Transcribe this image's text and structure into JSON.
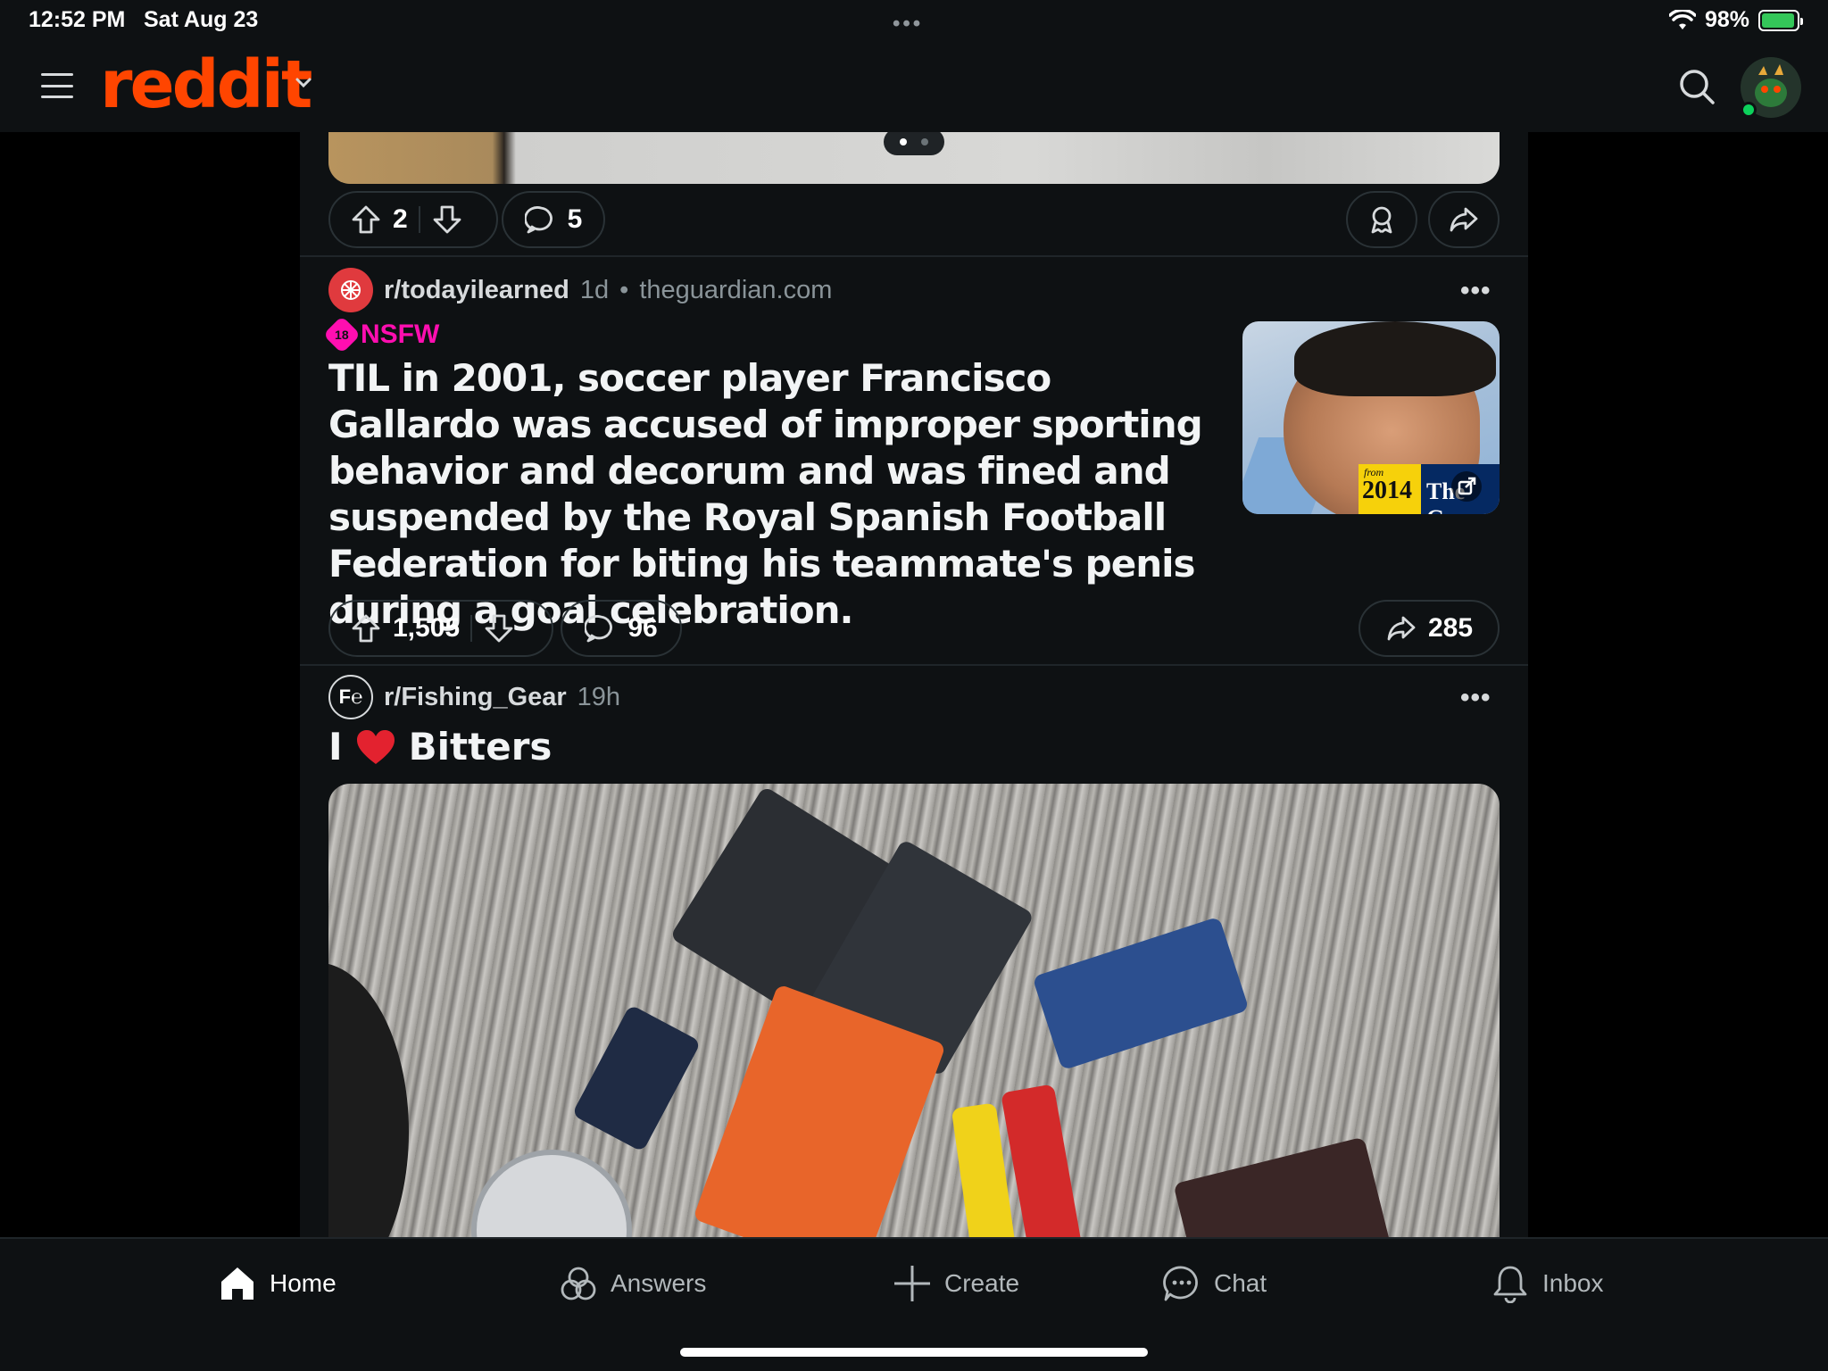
{
  "status_bar": {
    "time": "12:52 PM",
    "date": "Sat Aug 23",
    "battery": "98%",
    "battery_level": 0.98
  },
  "header": {
    "logo": "reddit"
  },
  "prev_post": {
    "upvotes": "2",
    "comments": "5"
  },
  "post1": {
    "subreddit": "r/todayilearned",
    "age": "1d",
    "domain": "theguardian.com",
    "nsfw_label": "NSFW",
    "nsfw_badge": "18",
    "title": "TIL in 2001, soccer player Francisco Gallardo was accused of improper sporting behavior and decorum and was fined and suspended by the Royal Spanish Football Federation for biting his teammate's penis during a goal celebration.",
    "thumb_from": "from",
    "thumb_year": "2014",
    "thumb_brand": "The Gu",
    "upvotes": "1,505",
    "comments": "96",
    "shares": "285"
  },
  "post2": {
    "subreddit": "r/Fishing_Gear",
    "subreddit_icon_text": "F℮",
    "age": "19h",
    "title_prefix": "I",
    "title_suffix": "Bitters"
  },
  "tabs": [
    {
      "label": "Home",
      "icon": "home-icon"
    },
    {
      "label": "Answers",
      "icon": "answers-icon"
    },
    {
      "label": "Create",
      "icon": "plus-icon"
    },
    {
      "label": "Chat",
      "icon": "chat-icon"
    },
    {
      "label": "Inbox",
      "icon": "bell-icon"
    }
  ],
  "colors": {
    "brand": "#ff4500",
    "nsfw": "#ff0eb0",
    "background": "#0e1113"
  }
}
